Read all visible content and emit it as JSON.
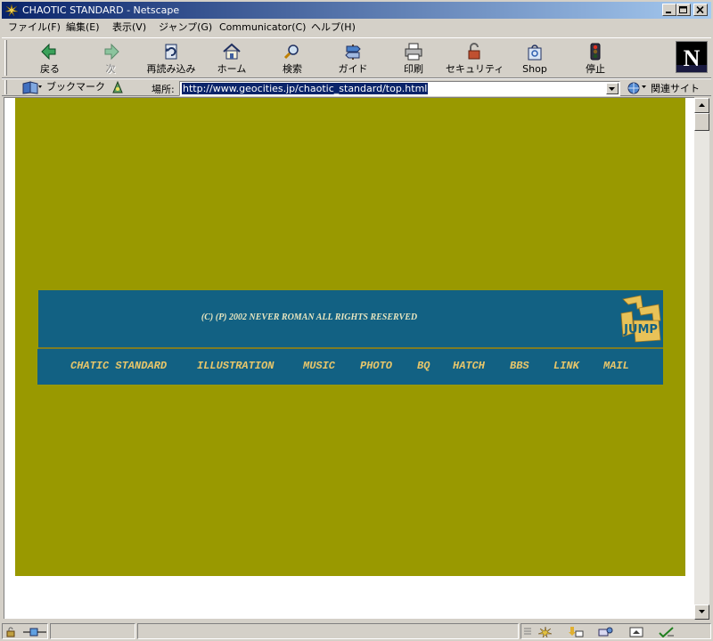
{
  "window": {
    "title": "CHAOTIC STANDARD - Netscape",
    "buttons": [
      "minimize",
      "maximize",
      "close"
    ]
  },
  "menu": [
    {
      "label": "ファイル(F)",
      "name": "menu-file"
    },
    {
      "label": "編集(E)",
      "name": "menu-edit"
    },
    {
      "label": "表示(V)",
      "name": "menu-view"
    },
    {
      "label": "ジャンプ(G)",
      "name": "menu-go"
    },
    {
      "label": "Communicator(C)",
      "name": "menu-communicator"
    },
    {
      "label": "ヘルプ(H)",
      "name": "menu-help"
    }
  ],
  "toolbar": {
    "back": "戻る",
    "forward": "次",
    "reload": "再読み込み",
    "home": "ホーム",
    "search": "検索",
    "guide": "ガイド",
    "print": "印刷",
    "security": "セキュリティ",
    "shop": "Shop",
    "stop": "停止"
  },
  "location": {
    "bookmarks": "ブックマーク",
    "label": "場所:",
    "url": "http://www.geocities.jp/chaotic_standard/top.html",
    "related": "関連サイト"
  },
  "page": {
    "copyright": "(C) (P) 2002 NEVER ROMAN ALL RIGHTS RESERVED",
    "logo_text": "JUMP",
    "nav": [
      "CHATIC STANDARD",
      "ILLUSTRATION",
      "MUSIC",
      "PHOTO",
      "BQ",
      "HATCH",
      "BBS",
      "LINK",
      "MAIL"
    ]
  },
  "colors": {
    "page_background": "#999900",
    "banner_background": "#126183",
    "nav_text": "#e7c66a",
    "title_bar": "#0a246a"
  }
}
